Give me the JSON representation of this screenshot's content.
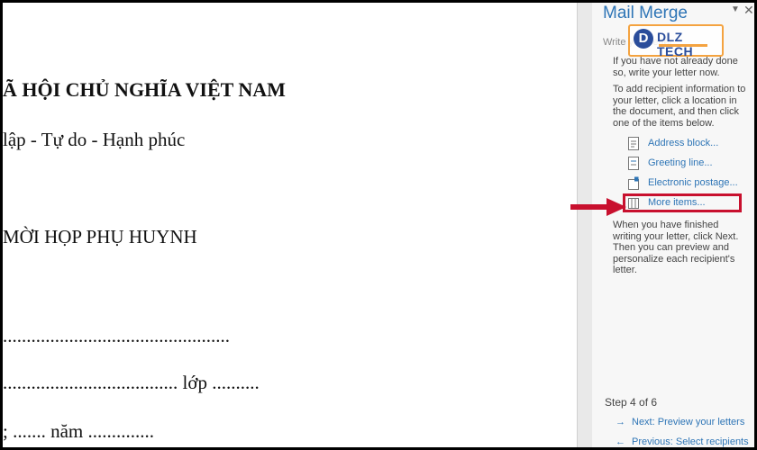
{
  "document": {
    "lines": [
      "Ã HỘI CHỦ NGHĨA VIỆT NAM",
      "lập - Tự do - Hạnh phúc",
      "MỜI HỌP PHỤ HUYNH",
      "................................................",
      "..................................... lớp ..........",
      "; ....... năm .............."
    ]
  },
  "pane": {
    "title": "Mail Merge",
    "dropdown_icon": "chevron-down-icon",
    "close_label": "✕",
    "section_label": "Write your letter",
    "watermark": {
      "letter": "D",
      "text": "DLZ TECH"
    },
    "intro_text": "If you have not already done so, write your letter now.",
    "instructions": "To add recipient information to your letter, click a location in the document, and then click one of the items below.",
    "items": [
      {
        "label": "Address block...",
        "icon": "address-block-icon"
      },
      {
        "label": "Greeting line...",
        "icon": "greeting-line-icon"
      },
      {
        "label": "Electronic postage...",
        "icon": "postage-icon"
      },
      {
        "label": "More items...",
        "icon": "more-items-icon"
      }
    ],
    "finish_text": "When you have finished writing your letter, click Next. Then you can preview and personalize each recipient's letter.",
    "step": "Step 4 of 6",
    "next_label": "Next: Preview your letters",
    "prev_label": "Previous: Select recipients"
  },
  "colors": {
    "accent": "#2e75b6",
    "highlight": "#c8102e",
    "watermark": "#f4a340"
  }
}
